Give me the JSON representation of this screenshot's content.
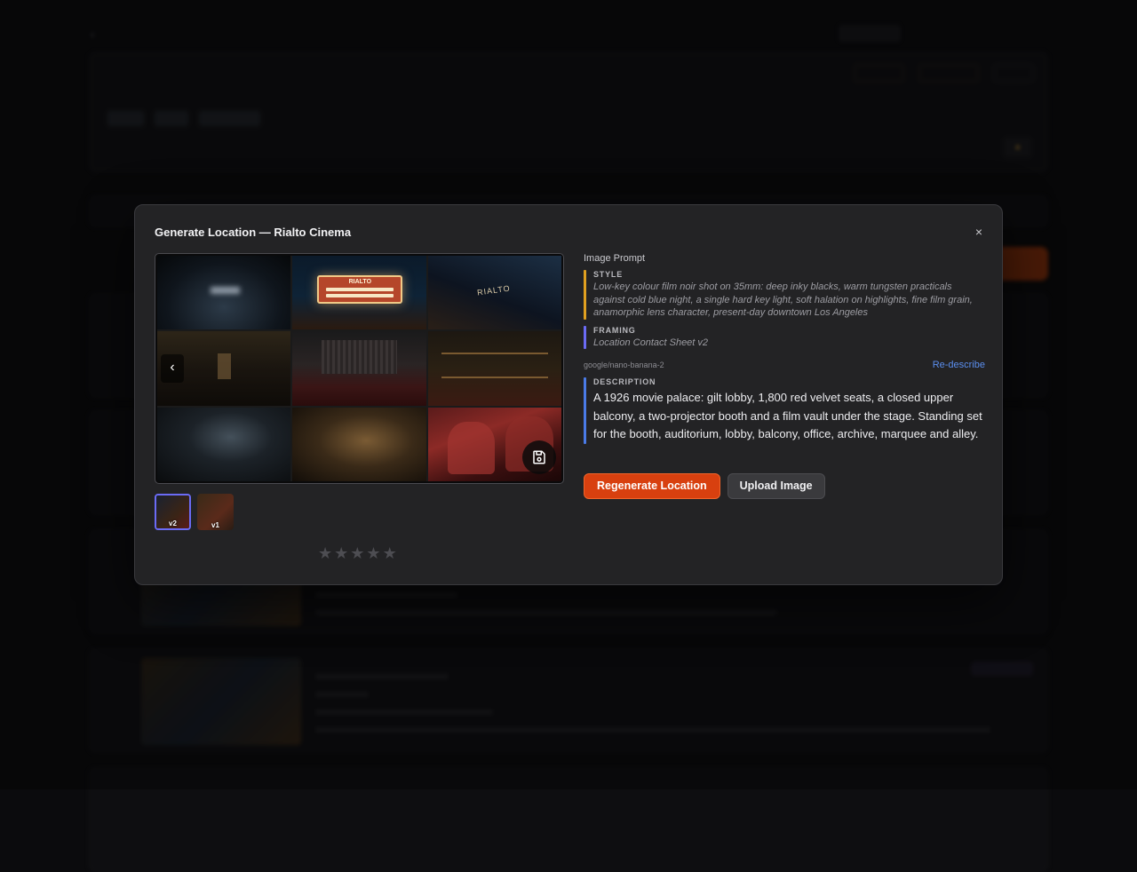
{
  "modal": {
    "title": "Generate Location — Rialto Cinema",
    "close_label": "×",
    "prompt_heading": "Image Prompt",
    "style": {
      "label": "STYLE",
      "text": "Low-key colour film noir shot on 35mm: deep inky blacks, warm tungsten practicals against cold blue night, a single hard key light, soft halation on highlights, fine film grain, anamorphic lens character, present-day downtown Los Angeles"
    },
    "framing": {
      "label": "FRAMING",
      "text": "Location Contact Sheet v2"
    },
    "model": "google/nano-banana-2",
    "redescribe_label": "Re-describe",
    "description": {
      "label": "DESCRIPTION",
      "text": "A 1926 movie palace: gilt lobby, 1,800 red velvet seats, a closed upper balcony, a two-projector booth and a film vault under the stage. Standing set for the booth, auditorium, lobby, balcony, office, archive, marquee and alley."
    },
    "buttons": {
      "regenerate": "Regenerate Location",
      "upload": "Upload Image"
    },
    "viewer": {
      "marquee_text": "RIALTO",
      "sign_text": "RIALTO",
      "prev_icon": "chevron-left-icon",
      "save_icon": "floppy-disk-icon"
    },
    "versions": [
      {
        "label": "v2",
        "selected": true
      },
      {
        "label": "v1",
        "selected": false
      }
    ],
    "rating": {
      "max": 5,
      "value": 0
    }
  },
  "colors": {
    "accent_orange": "#d8400f",
    "selected_outline": "#6b6bf5",
    "style_bar": "#e0a020",
    "framing_bar": "#6b6bf5",
    "description_bar": "#4a7be8",
    "link": "#5b8ff0"
  }
}
